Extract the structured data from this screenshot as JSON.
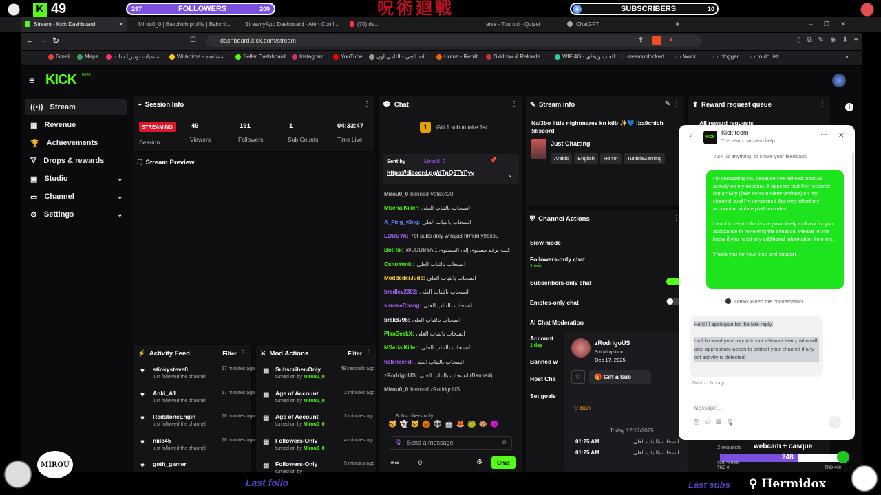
{
  "overlay": {
    "kick_count": "49",
    "followers_label": "FOLLOWERS",
    "followers_current": "297",
    "followers_goal": "200",
    "subscribers_label": "SUBSCRIBERS",
    "subscribers_current": "0",
    "subscribers_goal": "10",
    "logo_text": "MIROU",
    "bottom_left_text": "Last follo",
    "bottom_right_text": "Last subs",
    "brand_text": "Hermidox",
    "progress_label": "webcam + casque",
    "progress_requests": "2 requests",
    "progress_value": "248",
    "progress_fill": 0.62,
    "progress_left": "TND 0",
    "progress_right": "TND 400",
    "progress_mid": "Wet weee"
  },
  "browser": {
    "tabs": [
      {
        "label": "Stream - Kick Dashboard",
        "active": true,
        "color": "#53fc18"
      },
      {
        "label": "Mirou0_0 | Bakchich profile | Bakchi...",
        "active": false,
        "color": "#6aa0ff"
      },
      {
        "label": "StreamyApp Dashboard - Alert Confi...",
        "active": false,
        "color": "#8a8aff"
      },
      {
        "label": "(70) de...",
        "active": false,
        "color": "#ff3333"
      },
      {
        "label": "ares - Tournoi - Quizei",
        "active": false,
        "color": "#cccccc"
      },
      {
        "label": "ChatGPT",
        "active": false,
        "color": "#aaaaaa"
      }
    ],
    "url": "dashboard.kick.com/stream",
    "bookmarks": [
      "Gmail",
      "Maps",
      "منتديات تونيزيا سات",
      "WitAnime - مشاهدة...",
      "Seller Dashboard",
      "Instagram",
      "YouTube",
      "ادد الجي - الثامي اون...",
      "Home - Replit",
      "Skidrow & Reloade...",
      "WIFI4G - العاب وايفاي",
      "steamunlocked",
      "Work",
      "blogger",
      "to do list"
    ]
  },
  "kick": {
    "logo": "KICK",
    "logo_badge": "BETA",
    "sidebar": [
      {
        "label": "Stream",
        "active": true,
        "icon": "broadcast-icon"
      },
      {
        "label": "Revenue",
        "active": false,
        "icon": "revenue-icon"
      },
      {
        "label": "Achievements",
        "active": false,
        "icon": "trophy-icon"
      },
      {
        "label": "Drops & rewards",
        "active": false,
        "icon": "gift-icon"
      },
      {
        "label": "Studio",
        "active": false,
        "icon": "studio-icon",
        "chevron": "⌄"
      },
      {
        "label": "Channel",
        "active": false,
        "icon": "channel-icon",
        "chevron": "⌄"
      },
      {
        "label": "Settings",
        "active": false,
        "icon": "gear-icon",
        "chevron": "⌄"
      }
    ],
    "session": {
      "title": "Session Info",
      "status": "STREAMING",
      "status_sub": "Session",
      "stats": [
        {
          "value": "49",
          "label": "Viewers"
        },
        {
          "value": "191",
          "label": "Followers"
        },
        {
          "value": "1",
          "label": "Sub Counts"
        },
        {
          "value": "04:33:47",
          "label": "Time Live"
        }
      ]
    },
    "preview": {
      "title": "Stream Preview"
    },
    "chat": {
      "title": "Chat",
      "gift_text": "Gift 1 sub to take 1st",
      "pinned_label": "Sent by",
      "pinned_user": "Mirou0_0",
      "pinned_link": "https://discord.gg/dTpQ6TYPyy",
      "lines": [
        {
          "user": "Mirou0_0",
          "text": "banned Votex420",
          "color": "#bbbbbb",
          "system": true
        },
        {
          "user": "MSerialKiller:",
          "text": "انسحاب بالتباب العلى",
          "color": "#53fc18"
        },
        {
          "user": "A_Ping_King:",
          "text": "انسحاب بالتباب العلى",
          "color": "#6a8cff"
        },
        {
          "user": "LOUBYA:",
          "text": "7ot subs only w raja3 nrmlm y9osou",
          "color": "#b068ff"
        },
        {
          "user": "BotRix:",
          "text": "@LOUBYA كنت برقم مستوى إلى المستوى 1",
          "color": "#53fc18"
        },
        {
          "user": "OsitoYonki:",
          "text": "انسحاب بالتباب العلى",
          "color": "#53fc18"
        },
        {
          "user": "ModdederJude:",
          "text": "انسحاب بالتباب العلى",
          "color": "#ffd23a"
        },
        {
          "user": "bradley2302:",
          "text": "انسحاب بالتباب العلى",
          "color": "#b068ff"
        },
        {
          "user": "sinaweChang:",
          "text": "انسحاب بالتباب العلى",
          "color": "#b068ff"
        },
        {
          "user": "brak8796:",
          "text": "انسحاب بالتباب العلى",
          "color": "#ffffff"
        },
        {
          "user": "PlanSeekX:",
          "text": "انسحاب بالتباب العلى",
          "color": "#53fc18"
        },
        {
          "user": "MSerialKiller:",
          "text": "انسحاب بالتباب العلى",
          "color": "#53fc18"
        },
        {
          "user": "heleneend:",
          "text": "انسحاب بالتباب العلى",
          "color": "#b068ff"
        },
        {
          "user": "zRodrigoUS:",
          "text": "انسحاب بالتباب العلى (Banned)",
          "color": "#aaaaaa"
        },
        {
          "user": "Mirou0_0",
          "text": "banned zRodrigoUS",
          "color": "#bbbbbb",
          "system": true
        }
      ],
      "subs_only": "Subscribers only",
      "placeholder": "Send a message",
      "send": "Chat",
      "counter": "0"
    },
    "stream_info": {
      "title": "Stream info",
      "stream_title": "Nal3bo little nightmares kn ktib ✨💙 !ba9chich !discord",
      "category": "Just Chatting",
      "tags": [
        "Arabic",
        "English",
        "Horror",
        "TunisiaGaming"
      ]
    },
    "channel_actions": {
      "title": "Channel Actions",
      "rows": [
        "Slow mode",
        "Followers-only chat",
        "Subscribers-only chat",
        "Emotes-only chat",
        "AI Chat Moderation",
        "Account",
        "Banned w",
        "Host Cha",
        "Set goals"
      ],
      "followers_sub": "1 min",
      "account_sub": "1 day"
    },
    "user_card": {
      "name": "zRodrigoUS",
      "following_label": "Following since",
      "following_date": "Dec 17, 2025",
      "gift_btn": "Gift a Sub",
      "ban": "Ban",
      "today": "Today 12/17/2025",
      "lines": [
        {
          "time": "01:25 AM",
          "text": "انسحاب بالتباب العلى"
        },
        {
          "time": "01:25 AM",
          "text": "انسحاب بالتباب العلى"
        }
      ]
    },
    "reward_queue": {
      "title": "Reward request queue",
      "sub": "All reward requests"
    },
    "activity": {
      "title": "Activity Feed",
      "filter": "Filter",
      "items": [
        {
          "name": "stinkysteve0",
          "sub": "just followed the channel",
          "time": "17 minutes ago"
        },
        {
          "name": "Anki_A1",
          "sub": "just followed the channel",
          "time": "17 minutes ago"
        },
        {
          "name": "RedstoneEngin",
          "sub": "just followed the channel",
          "time": "18 minutes ago"
        },
        {
          "name": "niile45",
          "sub": "just followed the channel",
          "time": "18 minutes ago"
        },
        {
          "name": "goth_gamer",
          "sub": "",
          "time": ""
        }
      ]
    },
    "mod_actions": {
      "title": "Mod Actions",
      "filter": "Filter",
      "turned_on": "turned on by",
      "items": [
        {
          "name": "Subscriber-Only",
          "by": "Mirou0_0",
          "time": "49 seconds ago"
        },
        {
          "name": "Age of Account",
          "by": "Mirou0_0",
          "time": "2 minutes ago"
        },
        {
          "name": "Age of Account",
          "by": "Mirou0_0",
          "time": "3 minutes ago"
        },
        {
          "name": "Followers-Only",
          "by": "Mirou0_0",
          "time": "4 minutes ago"
        },
        {
          "name": "Followers-Only",
          "by": "",
          "time": "5 minutes ago"
        }
      ]
    }
  },
  "popup": {
    "title": "Kick team",
    "subtitle": "The team can also help",
    "prompt": "Ask us anything, or share your feedback.",
    "user_msg_1": "I'm contacting you because I've noticed unusual activity on my account. It appears that I've received bot activity (fake accounts/interactions) on my channel, and I'm concerned this may affect my account or violate platform rules.",
    "user_msg_2": "I want to report this issue proactively and ask for your assistance in reviewing the situation. Please let me know if you need any additional information from me.",
    "user_msg_3": "Thank you for your time and support.",
    "join_text": "Darko joined the conversation",
    "agent_msg_1": "Hello! I apologize for the late reply.",
    "agent_msg_2": "I will forward your report to our relevant team, who will take appropriate action to protect your channel if any bot activity is detected.",
    "agent_meta": "Darko · 1m ago",
    "placeholder": "Message..."
  },
  "colors": {
    "kick_green": "#53fc18",
    "bg": "#0b0b0d",
    "panel": "#141417",
    "streaming_red": "#e3152b",
    "overlay_purple": "#7b4fe0"
  }
}
